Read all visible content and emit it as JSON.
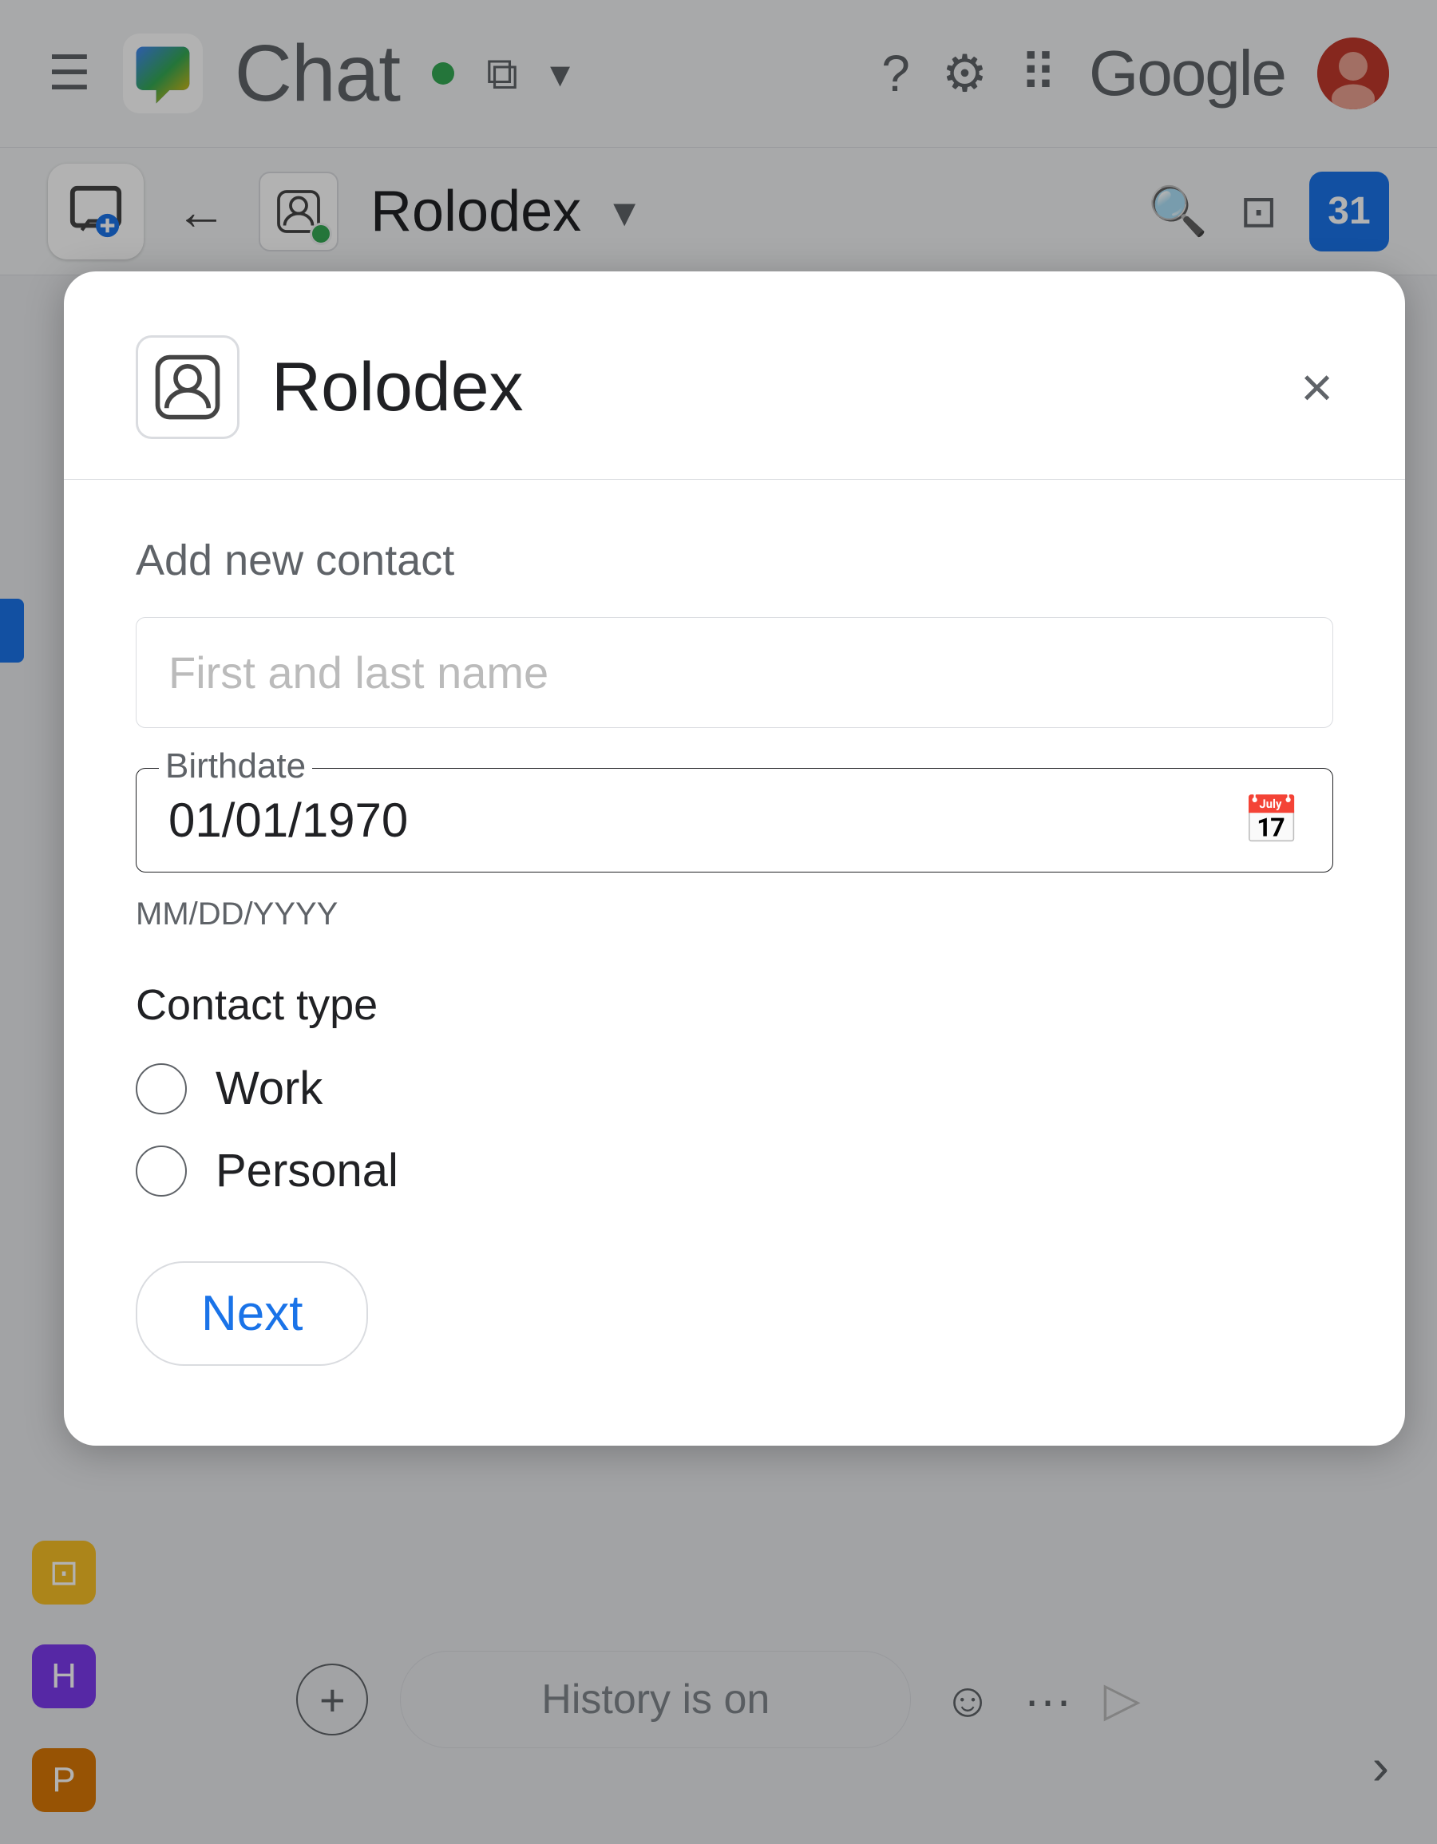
{
  "app": {
    "title": "Chat",
    "logo_alt": "Google Chat logo"
  },
  "header": {
    "hamburger_label": "☰",
    "status_color": "#34a853",
    "help_label": "?",
    "settings_label": "⚙",
    "grid_label": "⠿",
    "google_text": "Google"
  },
  "subheader": {
    "channel_name": "Rolodex",
    "dropdown_label": "▾",
    "calendar_num": "31"
  },
  "modal": {
    "title": "Rolodex",
    "close_label": "×",
    "section_label": "Add new contact",
    "name_placeholder": "First and last name",
    "birthdate_label": "Birthdate",
    "birthdate_value": "01/01/1970",
    "date_format_hint": "MM/DD/YYYY",
    "contact_type_label": "Contact type",
    "radio_options": [
      {
        "id": "work",
        "label": "Work"
      },
      {
        "id": "personal",
        "label": "Personal"
      }
    ],
    "next_button_label": "Next"
  },
  "bottom_bar": {
    "history_text": "History is on",
    "plus_label": "+",
    "emoji_label": "☺",
    "more_label": "•••",
    "send_label": "▷"
  },
  "icons": {
    "hamburger": "☰",
    "back_arrow": "←",
    "search": "🔍",
    "sidebar_toggle": "⬛",
    "close": "✕",
    "calendar": "📅",
    "compose": "🗨",
    "bot": "👤"
  }
}
